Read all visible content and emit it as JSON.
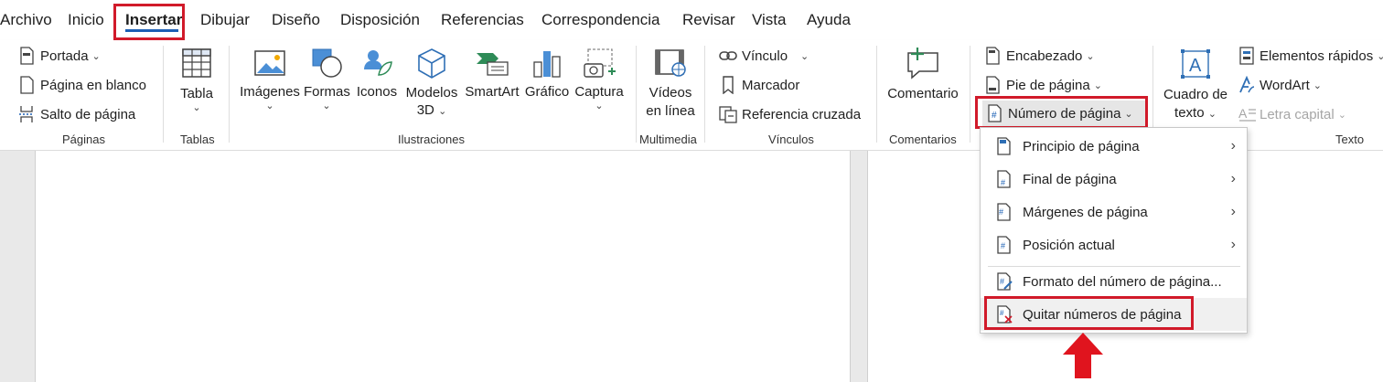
{
  "tabs": [
    "Archivo",
    "Inicio",
    "Insertar",
    "Dibujar",
    "Diseño",
    "Disposición",
    "Referencias",
    "Correspondencia",
    "Revisar",
    "Vista",
    "Ayuda"
  ],
  "active_tab": "Insertar",
  "groups": {
    "paginas": {
      "label": "Páginas",
      "portada": "Portada",
      "pagina_blanco": "Página en blanco",
      "salto_pagina": "Salto de página"
    },
    "tablas": {
      "label": "Tablas",
      "tabla": "Tabla"
    },
    "ilustraciones": {
      "label": "Ilustraciones",
      "imagenes": "Imágenes",
      "formas": "Formas",
      "iconos": "Iconos",
      "modelos_1": "Modelos",
      "modelos_2": "3D",
      "smartart": "SmartArt",
      "grafico": "Gráfico",
      "captura": "Captura"
    },
    "multimedia": {
      "label": "Multimedia",
      "videos_1": "Vídeos",
      "videos_2": "en línea"
    },
    "vinculos": {
      "label": "Vínculos",
      "vinculo": "Vínculo",
      "marcador": "Marcador",
      "referencia": "Referencia cruzada"
    },
    "comentarios": {
      "label": "Comentarios",
      "comentario": "Comentario"
    },
    "encabezado": {
      "encabezado": "Encabezado",
      "pie": "Pie de página",
      "numero": "Número de página"
    },
    "texto": {
      "label": "Texto",
      "cuadro_1": "Cuadro de",
      "cuadro_2": "texto",
      "elementos": "Elementos rápidos",
      "wordart": "WordArt",
      "letra": "Letra capital"
    }
  },
  "dropdown": {
    "items": [
      "Principio de página",
      "Final de página",
      "Márgenes de página",
      "Posición actual",
      "Formato del número de página...",
      "Quitar números de página"
    ]
  },
  "colors": {
    "accent": "#1a5fb4",
    "highlight": "#d11a2a",
    "arrow": "#e0141e"
  }
}
